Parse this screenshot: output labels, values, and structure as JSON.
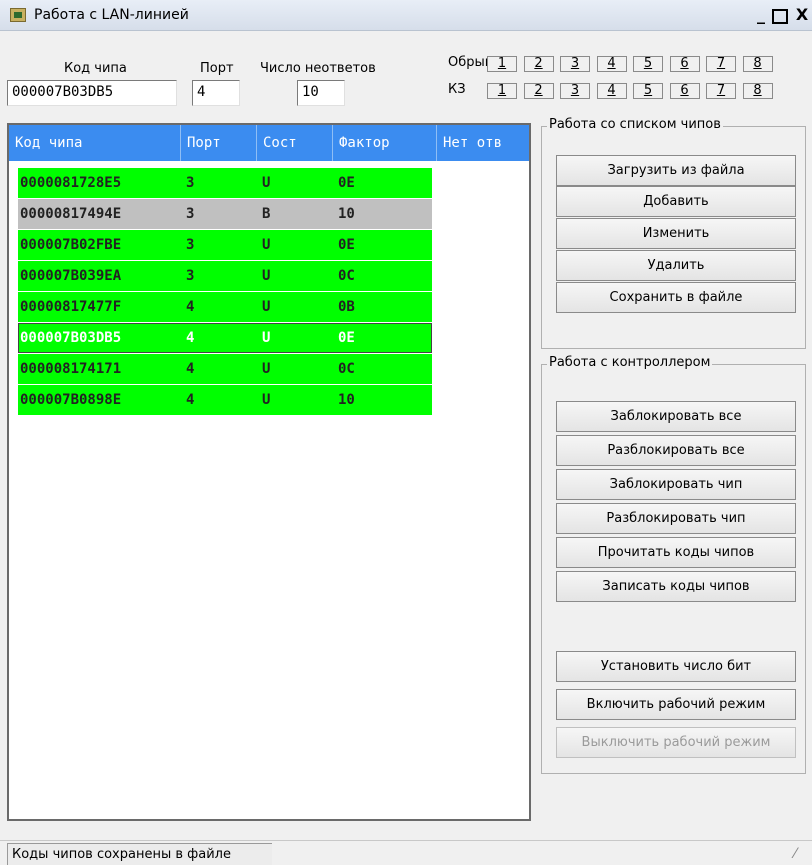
{
  "window": {
    "title": "Работа с LAN-линией",
    "minimize": "_",
    "close": "X"
  },
  "fields": {
    "chip_code_label": "Код чипа",
    "chip_code_value": "000007B03DB5",
    "port_label": "Порт",
    "port_value": "4",
    "no_answer_label": "Число неответов",
    "no_answer_value": "10"
  },
  "line_tests": {
    "break_label": "Обрыв",
    "short_label": "КЗ",
    "numbers": [
      "1",
      "2",
      "3",
      "4",
      "5",
      "6",
      "7",
      "8"
    ]
  },
  "table": {
    "headers": [
      "Код чипа",
      "Порт",
      "Сост",
      "Фактор",
      "Нет отв"
    ],
    "rows": [
      {
        "code": "000008172 8E5",
        "port": "3",
        "state": "U",
        "factor": "0E",
        "color": "#00ff00"
      },
      {
        "code": "00000817494E",
        "port": "3",
        "state": "B",
        "factor": "10",
        "color": "#c0c0c0"
      },
      {
        "code": "000007B02FBE",
        "port": "3",
        "state": "U",
        "factor": "0E",
        "color": "#00ff00"
      },
      {
        "code": "000007B039EA",
        "port": "3",
        "state": "U",
        "factor": "0C",
        "color": "#00ff00"
      },
      {
        "code": "00000817477F",
        "port": "4",
        "state": "U",
        "factor": "0B",
        "color": "#00ff00"
      },
      {
        "code": "000007B03DB5",
        "port": "4",
        "state": "U",
        "factor": "0E",
        "color": "#00ff00",
        "selected": true
      },
      {
        "code": "000008174171",
        "port": "4",
        "state": "U",
        "factor": "0C",
        "color": "#00ff00"
      },
      {
        "code": "000007B0898E",
        "port": "4",
        "state": "U",
        "factor": "10",
        "color": "#00ff00"
      }
    ]
  },
  "chip_list_group": {
    "title": "Работа со списком чипов",
    "buttons": [
      "Загрузить из файла",
      "Добавить",
      "Изменить",
      "Удалить",
      "Сохранить в файле"
    ]
  },
  "controller_group": {
    "title": "Работа с контроллером",
    "buttons": [
      "Заблокировать все",
      "Разблокировать все",
      "Заблокировать чип",
      "Разблокировать чип",
      "Прочитать коды чипов",
      "Записать коды чипов"
    ],
    "extra_buttons": [
      "Установить число бит",
      "Включить рабочий режим"
    ],
    "disabled_button": "Выключить рабочий режим"
  },
  "status_bar": {
    "text": "Коды чипов сохранены в файле"
  }
}
